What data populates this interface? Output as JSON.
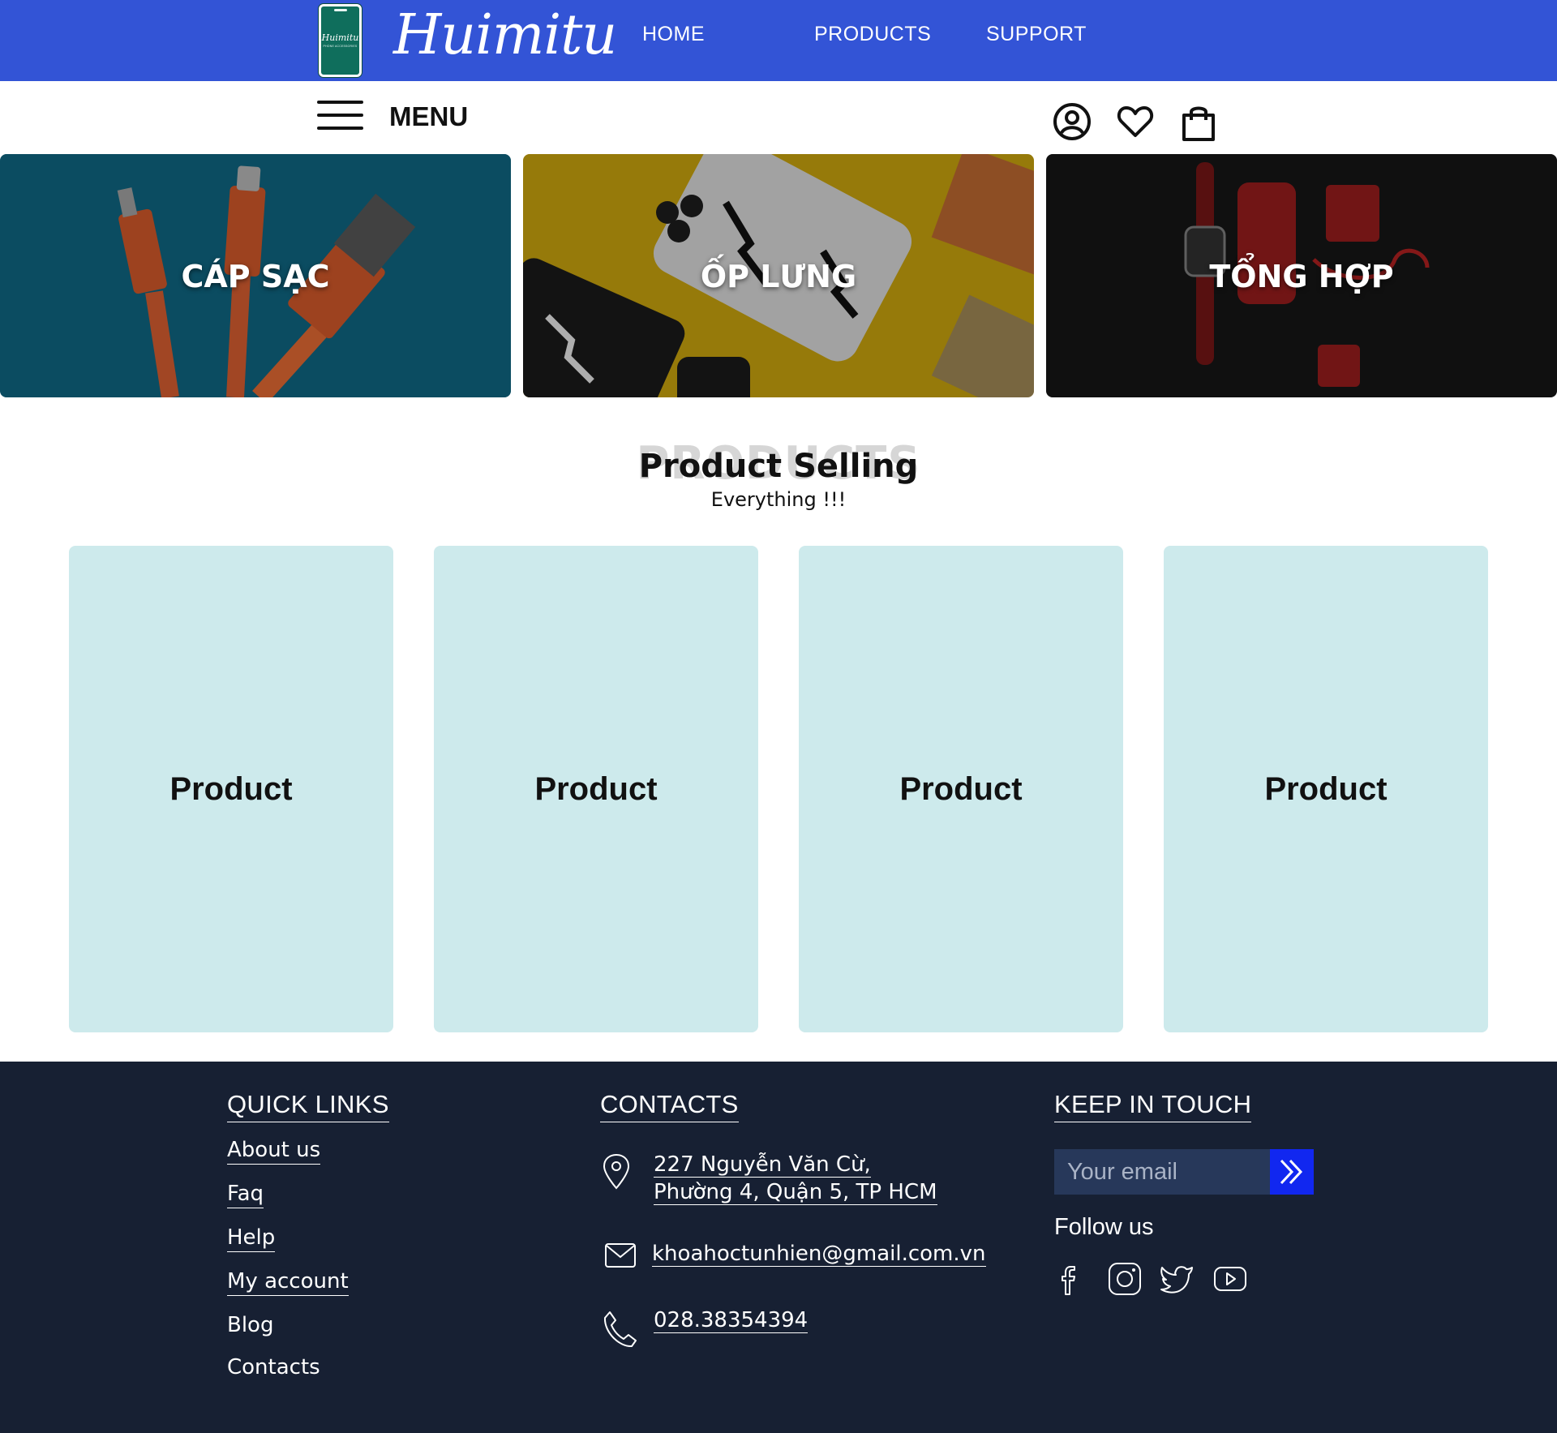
{
  "header": {
    "logo_text": "Huimitu",
    "logo_subtext": "PHONE ACCESSORIES",
    "brand": "Huimitu",
    "nav": [
      {
        "label": "HOME"
      },
      {
        "label": "PRODUCTS"
      },
      {
        "label": "SUPPORT"
      }
    ],
    "menu_label": "MENU",
    "icons": [
      "user-icon",
      "heart-icon",
      "shopping-bag-icon"
    ]
  },
  "banners": [
    {
      "label": "CÁP SẠC",
      "image": "charging-cables"
    },
    {
      "label": "ỐP LƯNG",
      "image": "phone-cases"
    },
    {
      "label": "TỔNG HỢP",
      "image": "accessories-flatlay"
    }
  ],
  "section": {
    "background_text": "PRODUCTS",
    "title": "Product Selling",
    "subtitle": "Everything !!!"
  },
  "products": [
    {
      "label": "Product"
    },
    {
      "label": "Product"
    },
    {
      "label": "Product"
    },
    {
      "label": "Product"
    }
  ],
  "footer": {
    "quick_links": {
      "heading": "QUICK LINKS",
      "items": [
        "About us",
        "Faq",
        "Help",
        "My account",
        "Blog",
        "Contacts"
      ]
    },
    "contacts": {
      "heading": "CONTACTS",
      "address_line1": "227 Nguyễn Văn Cừ,",
      "address_line2": "Phường 4, Quận 5, TP HCM",
      "email": "khoahoctunhien@gmail.com.vn",
      "phone": "028.38354394"
    },
    "keep_in_touch": {
      "heading": "KEEP IN TOUCH",
      "email_placeholder": "Your email",
      "follow_label": "Follow us",
      "social": [
        "facebook-icon",
        "instagram-icon",
        "twitter-icon",
        "youtube-icon"
      ]
    }
  },
  "colors": {
    "header_bg": "#3354d6",
    "card_bg": "#cdeaec",
    "footer_bg": "#172033",
    "subscribe_btn": "#1127f0"
  }
}
